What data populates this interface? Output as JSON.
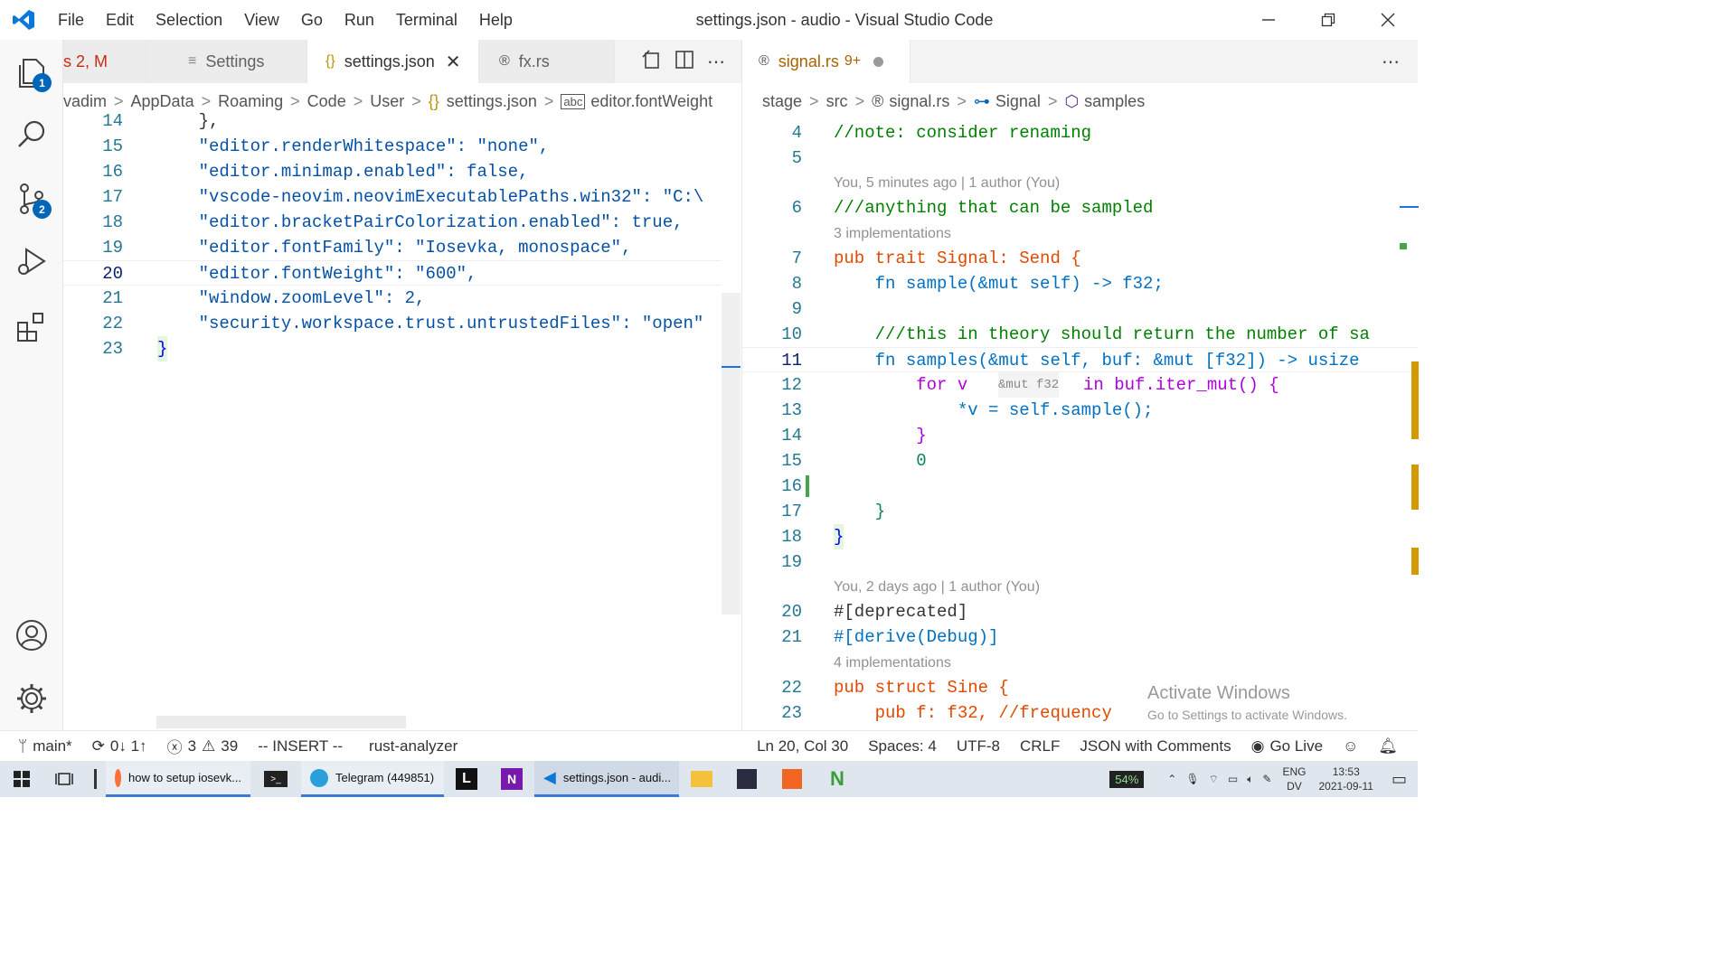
{
  "window": {
    "title": "settings.json - audio - Visual Studio Code",
    "menu": [
      "File",
      "Edit",
      "Selection",
      "View",
      "Go",
      "Run",
      "Terminal",
      "Help"
    ]
  },
  "activity": {
    "explorer_badge": "1",
    "scm_badge": "2"
  },
  "left": {
    "tabs": [
      {
        "label": "s 2, M",
        "icon": ""
      },
      {
        "label": "Settings",
        "icon": "≡"
      },
      {
        "label": "settings.json",
        "icon": "{}"
      },
      {
        "label": "fx.rs",
        "icon": "®"
      }
    ],
    "breadcrumb": [
      "vadim",
      "AppData",
      "Roaming",
      "Code",
      "User",
      "settings.json",
      "editor.fontWeight"
    ],
    "lines": [
      {
        "n": "14",
        "t": "    },"
      },
      {
        "n": "15",
        "t": "    \"editor.renderWhitespace\": \"none\","
      },
      {
        "n": "16",
        "t": "    \"editor.minimap.enabled\": false,"
      },
      {
        "n": "17",
        "t": "    \"vscode-neovim.neovimExecutablePaths.win32\": \"C:\\"
      },
      {
        "n": "18",
        "t": "    \"editor.bracketPairColorization.enabled\": true,"
      },
      {
        "n": "19",
        "t": "    \"editor.fontFamily\": \"Iosevka, monospace\","
      },
      {
        "n": "20",
        "t": "    \"editor.fontWeight\": \"600\","
      },
      {
        "n": "21",
        "t": "    \"window.zoomLevel\": 2,"
      },
      {
        "n": "22",
        "t": "    \"security.workspace.trust.untrustedFiles\": \"open\""
      },
      {
        "n": "23",
        "t": "}"
      }
    ]
  },
  "right": {
    "tab": {
      "label": "signal.rs",
      "badge": "9+"
    },
    "breadcrumb": [
      "stage",
      "src",
      "signal.rs",
      "Signal",
      "samples"
    ],
    "lens1": "You, 5 minutes ago | 1 author (You)",
    "lens2": "3 implementations",
    "lens3": "You, 2 days ago | 1 author (You)",
    "lens4": "4 implementations",
    "hint": "&mut f32",
    "lines": [
      {
        "n": "4",
        "t": "//note: consider renaming"
      },
      {
        "n": "5",
        "t": ""
      },
      {
        "n": "6",
        "t": "///anything that can be sampled"
      },
      {
        "n": "7",
        "t": "pub trait Signal: Send {"
      },
      {
        "n": "8",
        "t": "    fn sample(&mut self) -> f32;"
      },
      {
        "n": "9",
        "t": ""
      },
      {
        "n": "10",
        "t": "    ///this in theory should return the number of sa"
      },
      {
        "n": "11",
        "t": "    fn samples(&mut self, buf: &mut [f32]) -> usize"
      },
      {
        "n": "12",
        "t": "        for v"
      },
      {
        "n": "13",
        "t": "            *v = self.sample();"
      },
      {
        "n": "14",
        "t": "        }"
      },
      {
        "n": "15",
        "t": "        0"
      },
      {
        "n": "16",
        "t": ""
      },
      {
        "n": "17",
        "t": "    }"
      },
      {
        "n": "18",
        "t": "}"
      },
      {
        "n": "19",
        "t": ""
      },
      {
        "n": "20",
        "t": "#[deprecated]"
      },
      {
        "n": "21",
        "t": "#[derive(Debug)]"
      },
      {
        "n": "22",
        "t": "pub struct Sine {"
      },
      {
        "n": "23",
        "t": "    pub f: f32, //frequency"
      }
    ]
  },
  "status": {
    "branch": "main*",
    "sync": "0↓ 1↑",
    "errors": "3",
    "warnings": "39",
    "mode": "-- INSERT --",
    "server": "rust-analyzer",
    "position": "Ln 20, Col 30",
    "spaces": "Spaces: 4",
    "encoding": "UTF-8",
    "eol": "CRLF",
    "language": "JSON with Comments",
    "golive": "Go Live"
  },
  "watermark": {
    "title": "Activate Windows",
    "subtitle": "Go to Settings to activate Windows."
  },
  "taskbar": {
    "apps": [
      {
        "label": "how to setup iosevk...",
        "icon": "firefox-icon"
      },
      {
        "label": "",
        "icon": "terminal-icon"
      },
      {
        "label": "Telegram (449851)",
        "icon": "telegram-icon"
      },
      {
        "label": "",
        "icon": "l-app-icon"
      },
      {
        "label": "",
        "icon": "onenote-icon"
      },
      {
        "label": "settings.json - audi...",
        "icon": "vscode-icon"
      }
    ],
    "battery": "54%",
    "lang1": "ENG",
    "lang2": "DV",
    "time": "13:53",
    "date": "2021-09-11"
  },
  "colors": {
    "accent": "#0066b8",
    "json_key": "#0451a5",
    "json_string": "#a31515",
    "keyword": "#af00db",
    "rust_type": "#0070c1"
  }
}
